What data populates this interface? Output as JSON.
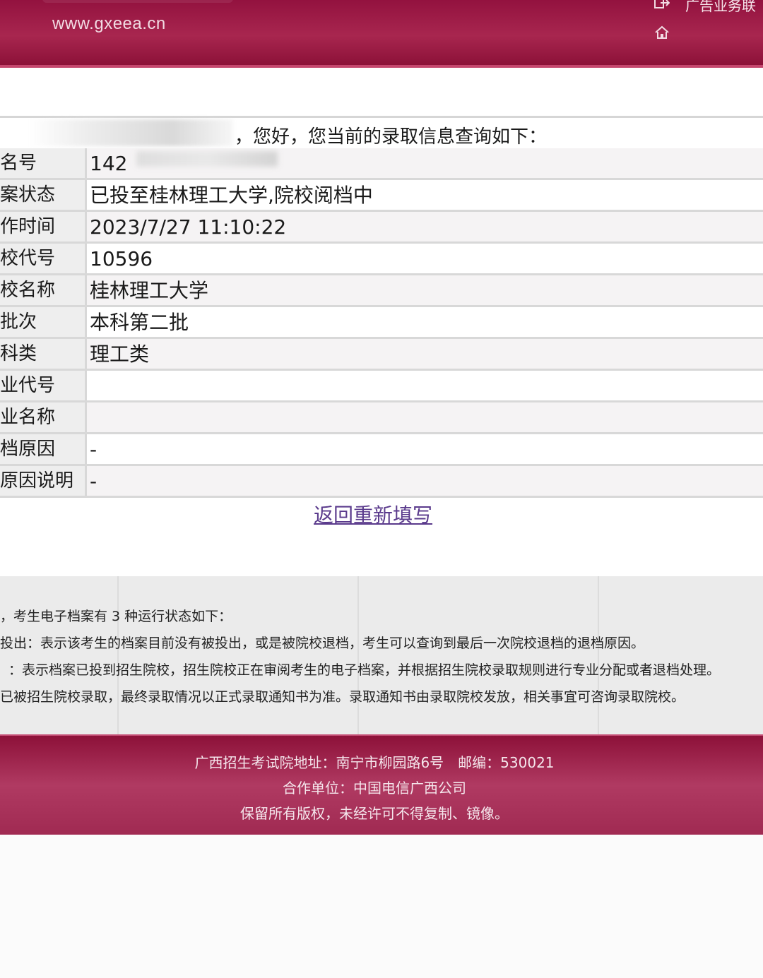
{
  "header": {
    "site_url": "www.gxeea.cn",
    "top_link": "广告业务联",
    "icons": [
      "logout-icon",
      "home-icon"
    ]
  },
  "greeting": {
    "text": "，您好，您当前的录取信息查询如下："
  },
  "info_rows": [
    {
      "label": "名号",
      "value": "142"
    },
    {
      "label": "案状态",
      "value": "已投至桂林理工大学,院校阅档中"
    },
    {
      "label": "作时间",
      "value": "2023/7/27 11:10:22"
    },
    {
      "label": "校代号",
      "value": "10596"
    },
    {
      "label": "校名称",
      "value": "桂林理工大学"
    },
    {
      "label": "批次",
      "value": "本科第二批"
    },
    {
      "label": "科类",
      "value": "理工类"
    },
    {
      "label": "业代号",
      "value": ""
    },
    {
      "label": "业名称",
      "value": ""
    },
    {
      "label": "档原因",
      "value": "-"
    },
    {
      "label": "原因说明",
      "value": "-"
    }
  ],
  "back_link": "返回重新填写",
  "notes": [
    "，考生电子档案有 3 种运行状态如下：",
    "投出：表示该考生的档案目前没有被投出，或是被院校退档，考生可以查询到最后一次院校退档的退档原因。",
    "：表示档案已投到招生院校，招生院校正在审阅考生的电子档案，并根据招生院校录取规则进行专业分配或者退档处理。",
    "已被招生院校录取，最终录取情况以正式录取通知书为准。录取通知书由录取院校发放，相关事宜可咨询录取院校。"
  ],
  "footer": {
    "address": "广西招生考试院地址：南宁市柳园路6号　邮编：530021",
    "partner": "合作单位：中国电信广西公司",
    "copyright": "保留所有版权，未经许可不得复制、镜像。"
  }
}
